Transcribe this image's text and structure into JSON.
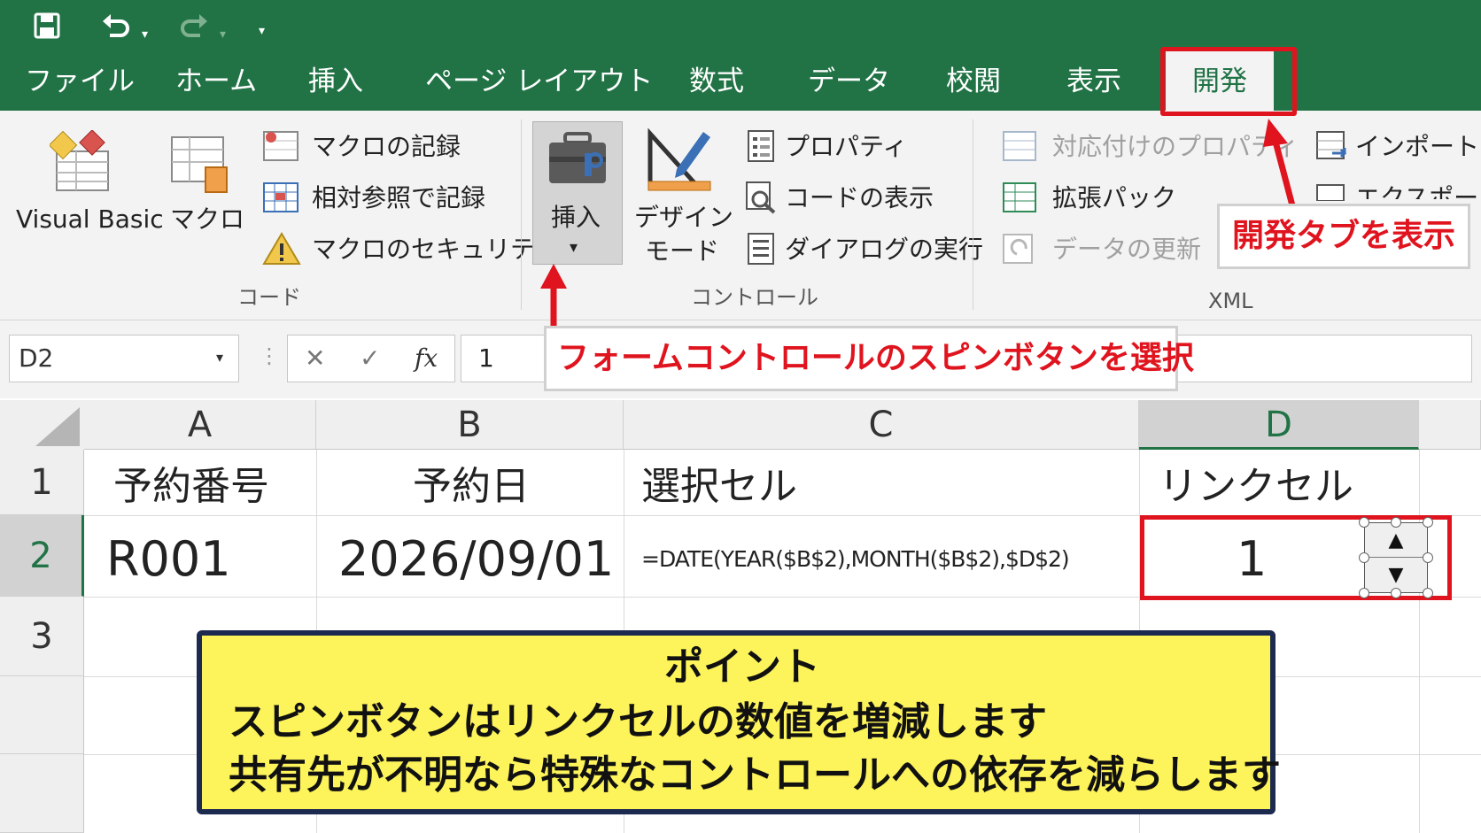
{
  "quick_access": {
    "save_icon": "save-icon",
    "undo_icon": "undo-icon",
    "redo_icon": "redo-icon",
    "customize_icon": "customize-qat-icon"
  },
  "tabs": [
    "ファイル",
    "ホーム",
    "挿入",
    "ページ レイアウト",
    "数式",
    "データ",
    "校閲",
    "表示",
    "開発"
  ],
  "active_tab": "開発",
  "ribbon": {
    "code": {
      "visual_basic": "Visual Basic",
      "macro": "マクロ",
      "record_macro": "マクロの記録",
      "relative_ref": "相対参照で記録",
      "macro_security": "マクロのセキュリティ",
      "label": "コード"
    },
    "controls": {
      "insert": "挿入",
      "design_mode_line1": "デザイン",
      "design_mode_line2": "モード",
      "properties": "プロパティ",
      "view_code": "コードの表示",
      "run_dialog": "ダイアログの実行",
      "label": "コントロール"
    },
    "xml": {
      "map_properties": "対応付けのプロパティ",
      "expansion_packs": "拡張パック",
      "refresh_data": "データの更新",
      "import": "インポート",
      "export": "エクスポート",
      "label": "XML"
    }
  },
  "formula_bar": {
    "name_box": "D2",
    "cancel": "✕",
    "enter": "✓",
    "fx": "fx",
    "value": "1"
  },
  "sheet": {
    "columns": [
      "A",
      "B",
      "C",
      "D"
    ],
    "rows": [
      "1",
      "2",
      "3"
    ],
    "cells": {
      "A1": "予約番号",
      "B1": "予約日",
      "C1": "選択セル",
      "D1": "リンクセル",
      "A2": "R001",
      "B2": "2026/09/01",
      "C2": "=DATE(YEAR($B$2),MONTH($B$2),$D$2)",
      "D2": "1"
    },
    "spin_up": "▲",
    "spin_down": "▼"
  },
  "callouts": {
    "developer_tab": "開発タブを表示",
    "spin_button": "フォームコントロールのスピンボタンを選択"
  },
  "point_box": {
    "title": "ポイント",
    "line1": "スピンボタンはリンクセルの数値を増減します",
    "line2": "共有先が不明なら特殊なコントロールへの依存を減らします"
  },
  "colors": {
    "excel_green": "#217346",
    "highlight_red": "#e0141e",
    "point_yellow": "#fdf35a",
    "point_border": "#1d2a4f"
  }
}
